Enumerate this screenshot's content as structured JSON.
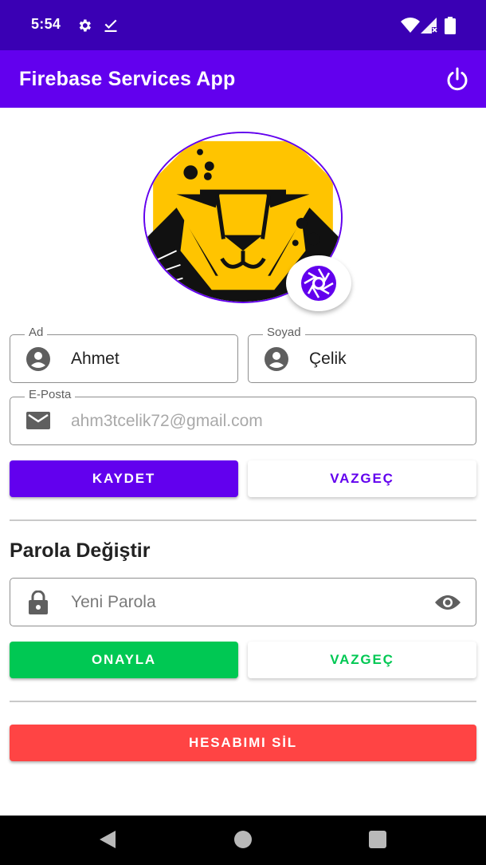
{
  "status_bar": {
    "time": "5:54",
    "icons": [
      "gear-icon",
      "download-done-icon",
      "wifi-icon",
      "signal-icon",
      "battery-icon"
    ]
  },
  "app_bar": {
    "title": "Firebase Services App",
    "action_icon": "power-icon"
  },
  "profile": {
    "avatar_icon": "cheetah-avatar",
    "camera_icon": "camera-shutter-icon"
  },
  "form": {
    "first_name": {
      "label": "Ad",
      "value": "Ahmet",
      "icon": "account-circle-icon"
    },
    "last_name": {
      "label": "Soyad",
      "value": "Çelik",
      "icon": "account-circle-icon"
    },
    "email": {
      "label": "E-Posta",
      "placeholder": "ahm3tcelik72@gmail.com",
      "icon": "mail-icon"
    },
    "save_label": "KAYDET",
    "cancel_label": "VAZGEÇ"
  },
  "password": {
    "section_title": "Parola Değiştir",
    "new_password_placeholder": "Yeni Parola",
    "lock_icon": "lock-icon",
    "eye_icon": "eye-icon",
    "confirm_label": "ONAYLA",
    "cancel_label": "VAZGEÇ"
  },
  "danger": {
    "delete_label": "HESABIMI SİL"
  },
  "colors": {
    "status_bar": "#3a00b4",
    "primary": "#6200ee",
    "green": "#00c853",
    "red": "#ff4444"
  }
}
